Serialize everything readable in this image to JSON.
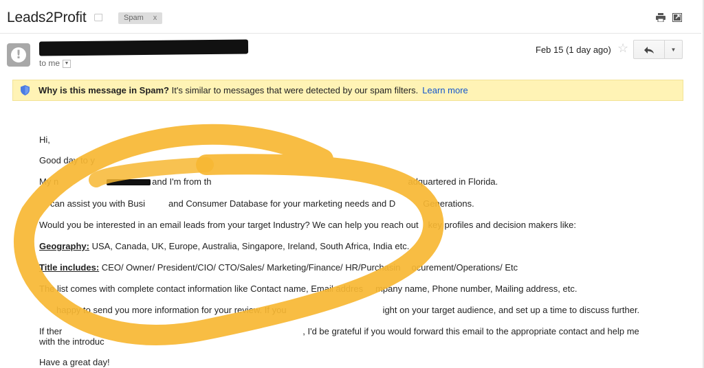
{
  "header": {
    "subject": "Leads2Profit",
    "label": "Spam",
    "label_close": "x",
    "print_icon": "printer-icon",
    "new_window_icon": "new-window-icon"
  },
  "sender": {
    "avatar_icon": "warning-icon",
    "to": "to me",
    "date": "Feb 15 (1 day ago)",
    "star_icon": "star-icon",
    "reply_icon": "reply-icon",
    "more_icon": "chevron-down-icon"
  },
  "banner": {
    "icon": "shield-icon",
    "title": "Why is this message in Spam?",
    "text": " It's similar to messages that were detected by our spam filters.",
    "link": "Learn more"
  },
  "body": {
    "greeting": "Hi,",
    "line1": "Good day to y",
    "line2a": "My n",
    "line2b": "and I'm from th",
    "line2c": "adquartered in Florida.",
    "line3a": "can assist you with Busi",
    "line3b": "and Consumer Database for your marketing needs and D",
    "line3c": "Generations.",
    "line4a": "Would you be interested in an email leads from your target Industry? We can help you reach out",
    "line4b": "key profiles and decision makers like:",
    "geo_label": "Geography:",
    "geo_text": " USA, Canada, UK, Europe, Australia, Singapore, Ireland, South Africa, India etc.",
    "title_label": "Title includes:",
    "title_text_a": " CEO/ Owner/ President/CIO/ CTO/Sales/ Marketing/Finance/ HR/Purchasin",
    "title_text_b": "ocurement/Operations/ Etc",
    "list_a": "The list comes with complete contact information like Contact name, Email addres",
    "list_b": "mpany name, Phone number, Mailing address, etc.",
    "happy_a": "happy to send you more information for your review. If you",
    "happy_b": "ight on your target audience, and set up a time to discuss further.",
    "if_a": "If ther",
    "if_b": ", I'd be grateful if you would forward this email to the appropriate contact and help me",
    "intro": "with the introduc",
    "closing": "Have a great day!"
  },
  "colors": {
    "banner_bg": "#fff3b5",
    "link": "#1155cc",
    "highlighter": "#f7b733"
  }
}
